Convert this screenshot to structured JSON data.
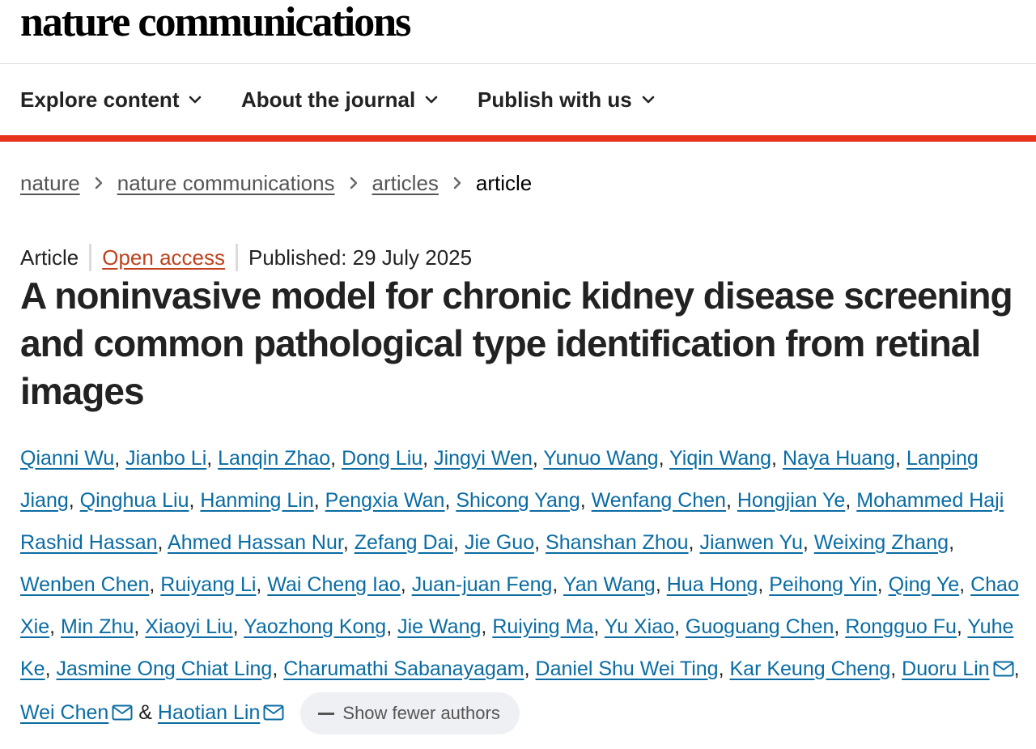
{
  "header": {
    "logo": "nature communications"
  },
  "nav": {
    "items": [
      {
        "label": "Explore content",
        "icon": "chevron-down-icon"
      },
      {
        "label": "About the journal",
        "icon": "chevron-down-icon"
      },
      {
        "label": "Publish with us",
        "icon": "chevron-down-icon"
      }
    ]
  },
  "breadcrumb": {
    "items": [
      "nature",
      "nature communications",
      "articles"
    ],
    "current": "article"
  },
  "article": {
    "type": "Article",
    "access": "Open access",
    "published": "Published: 29 July 2025",
    "title": "A noninvasive model for chronic kidney disease screening and common pathological type identification from retinal images"
  },
  "authors": {
    "list": [
      {
        "name": "Qianni Wu"
      },
      {
        "name": "Jianbo Li"
      },
      {
        "name": "Lanqin Zhao"
      },
      {
        "name": "Dong Liu"
      },
      {
        "name": "Jingyi Wen"
      },
      {
        "name": "Yunuo Wang"
      },
      {
        "name": "Yiqin Wang"
      },
      {
        "name": "Naya Huang"
      },
      {
        "name": "Lanping Jiang"
      },
      {
        "name": "Qinghua Liu"
      },
      {
        "name": "Hanming Lin"
      },
      {
        "name": "Pengxia Wan"
      },
      {
        "name": "Shicong Yang"
      },
      {
        "name": "Wenfang Chen"
      },
      {
        "name": "Hongjian Ye"
      },
      {
        "name": "Mohammed Haji Rashid Hassan"
      },
      {
        "name": "Ahmed Hassan Nur"
      },
      {
        "name": "Zefang Dai"
      },
      {
        "name": "Jie Guo"
      },
      {
        "name": "Shanshan Zhou"
      },
      {
        "name": "Jianwen Yu"
      },
      {
        "name": "Weixing Zhang"
      },
      {
        "name": "Wenben Chen"
      },
      {
        "name": "Ruiyang Li"
      },
      {
        "name": "Wai Cheng Iao"
      },
      {
        "name": "Juan-juan Feng"
      },
      {
        "name": "Yan Wang"
      },
      {
        "name": "Hua Hong"
      },
      {
        "name": "Peihong Yin"
      },
      {
        "name": "Qing Ye"
      },
      {
        "name": "Chao Xie"
      },
      {
        "name": "Min Zhu"
      },
      {
        "name": "Xiaoyi Liu"
      },
      {
        "name": "Yaozhong Kong"
      },
      {
        "name": "Jie Wang"
      },
      {
        "name": "Ruiying Ma"
      },
      {
        "name": "Yu Xiao"
      },
      {
        "name": "Guoguang Chen"
      },
      {
        "name": "Rongguo Fu"
      },
      {
        "name": "Yuhe Ke"
      },
      {
        "name": "Jasmine Ong Chiat Ling"
      },
      {
        "name": "Charumathi Sabanayagam"
      },
      {
        "name": "Daniel Shu Wei Ting"
      },
      {
        "name": "Kar Keung Cheng"
      },
      {
        "name": "Duoru Lin",
        "corresponding": true
      },
      {
        "name": "Wei Chen",
        "corresponding": true
      },
      {
        "name": "Haotian Lin",
        "corresponding": true
      }
    ],
    "separator": ", ",
    "final_separator": " & ",
    "show_fewer_label": "Show fewer authors",
    "mail_icon": "mail-icon"
  },
  "colors": {
    "accent_red": "#e6331c",
    "link_blue": "#0a6ca3",
    "open_access": "#c1421c",
    "text": "#222222"
  }
}
